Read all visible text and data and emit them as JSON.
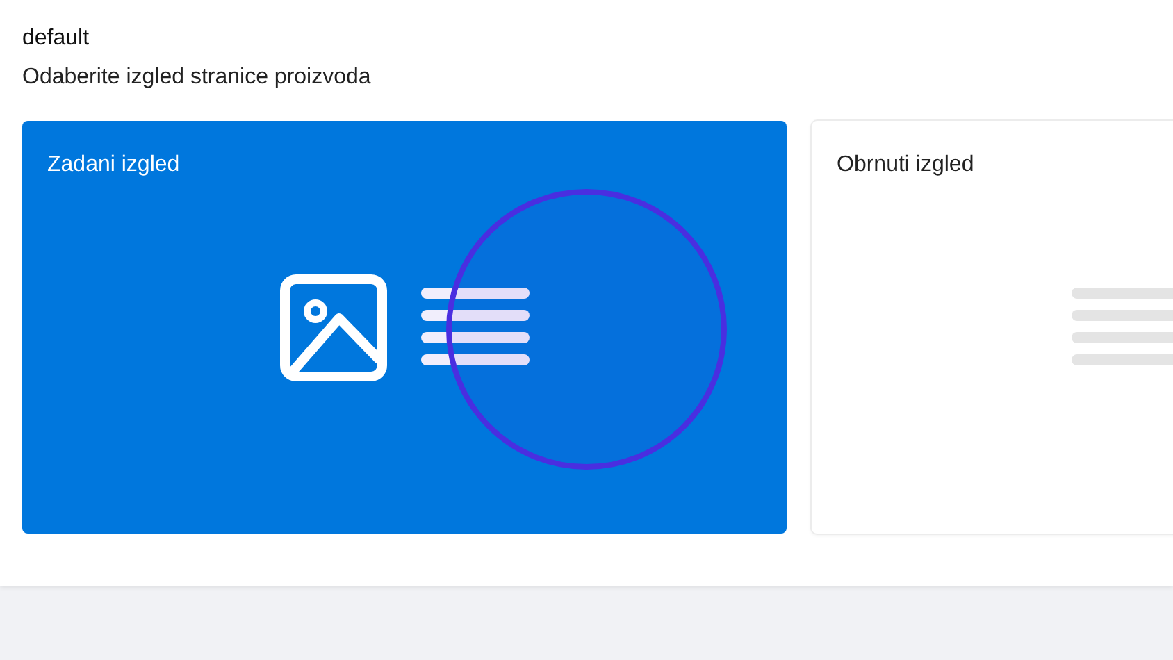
{
  "title": "default",
  "subtitle": "Odaberite izgled stranice proizvoda",
  "layouts": [
    {
      "label": "Zadani izgled",
      "kind": "image-first",
      "selected": true
    },
    {
      "label": "Obrnuti izgled",
      "kind": "text-first",
      "selected": false
    }
  ]
}
